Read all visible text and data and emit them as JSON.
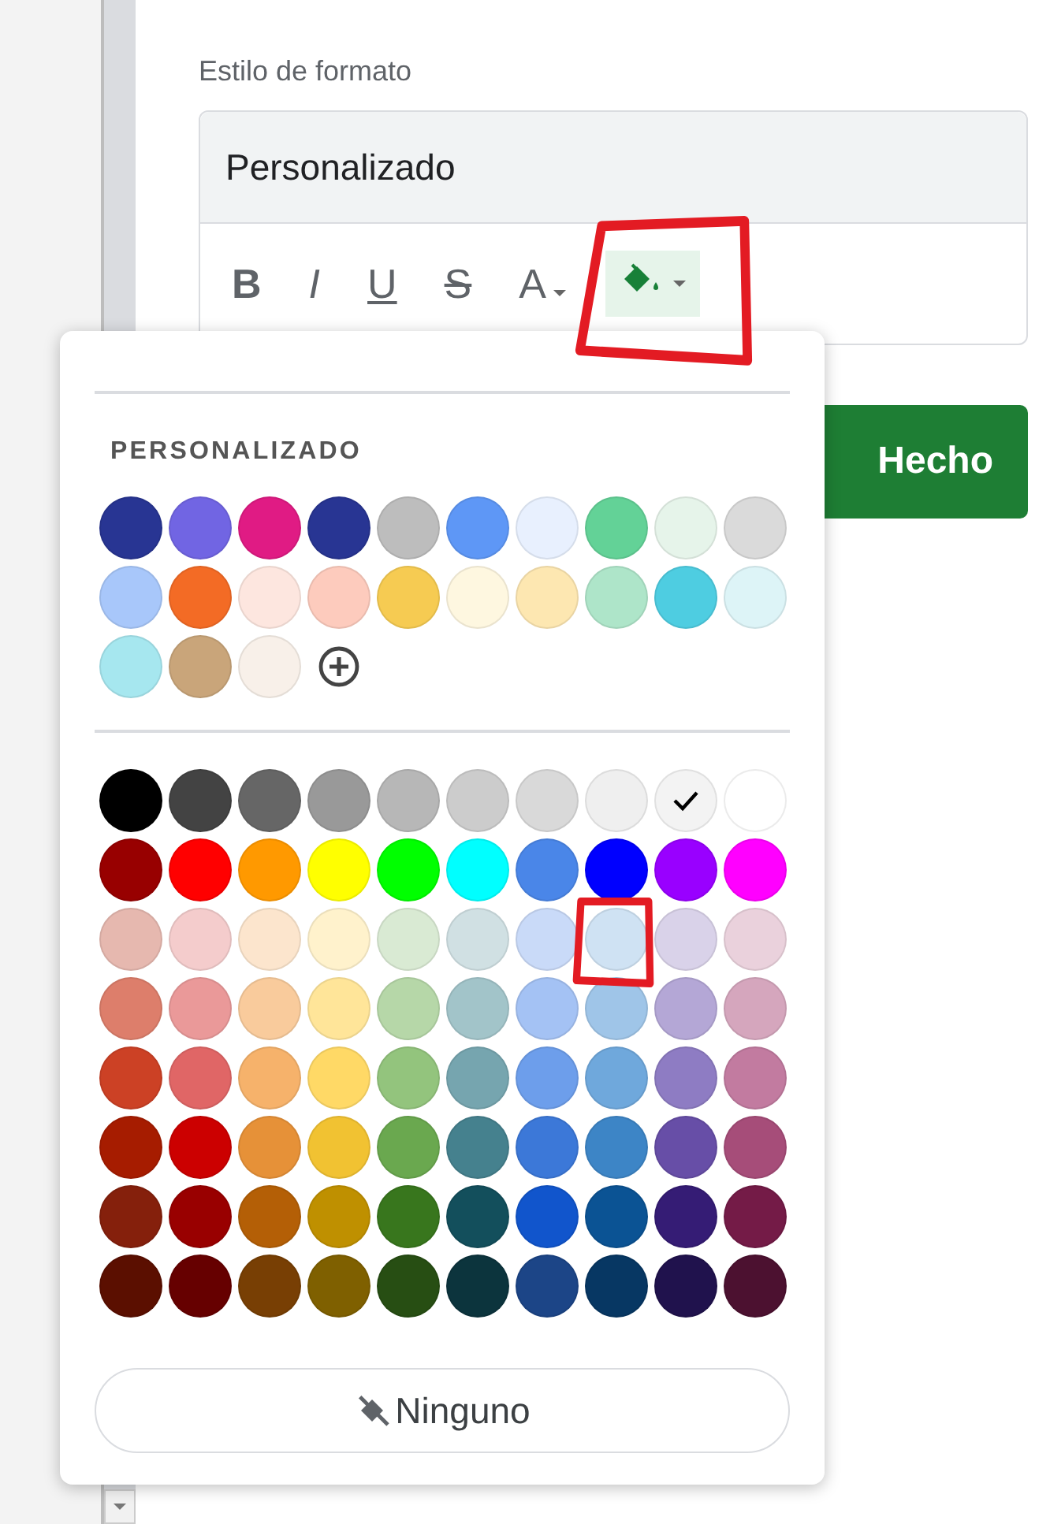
{
  "format_style": {
    "label": "Estilo de formato",
    "preset": "Personalizado",
    "toolbar": [
      {
        "kind": "bold",
        "label": "B",
        "selected": false
      },
      {
        "kind": "italic",
        "label": "I",
        "selected": false
      },
      {
        "kind": "underline",
        "label": "U",
        "selected": false
      },
      {
        "kind": "strike",
        "label": "S",
        "selected": false
      },
      {
        "kind": "text_color",
        "label": "A",
        "selected": false
      },
      {
        "kind": "fill_color",
        "selected": true,
        "highlighted": true
      }
    ]
  },
  "done_button": "Hecho",
  "color_menu": {
    "custom_heading": "PERSONALIZADO",
    "custom": [
      {
        "color": "#283593",
        "selected": false
      },
      {
        "color": "#7165e3",
        "selected": false
      },
      {
        "color": "#e01b84",
        "selected": false
      },
      {
        "color": "#283593",
        "selected": false
      },
      {
        "color": "#bdbdbd",
        "selected": false
      },
      {
        "color": "#5e97f6",
        "selected": false
      },
      {
        "color": "#e8f0fe",
        "selected": false
      },
      {
        "color": "#63d297",
        "selected": false
      },
      {
        "color": "#e6f4ea",
        "selected": false
      },
      {
        "color": "#dadada",
        "selected": false
      },
      {
        "color": "#a8c7fa",
        "selected": false
      },
      {
        "color": "#f36b25",
        "selected": false
      },
      {
        "color": "#fde6df",
        "selected": false
      },
      {
        "color": "#fdcbbd",
        "selected": false
      },
      {
        "color": "#f6cb52",
        "selected": false
      },
      {
        "color": "#fef7e0",
        "selected": false
      },
      {
        "color": "#fde7b1",
        "selected": false
      },
      {
        "color": "#aee5c9",
        "selected": false
      },
      {
        "color": "#4ecde1",
        "selected": false
      },
      {
        "color": "#ddf4f7",
        "selected": false
      },
      {
        "color": "#a6e7ef",
        "selected": false
      },
      {
        "color": "#c9a57a",
        "selected": false
      },
      {
        "color": "#f8f0e9",
        "selected": false
      }
    ],
    "standard": [
      [
        {
          "color": "#000000",
          "selected": false
        },
        {
          "color": "#434343",
          "selected": false
        },
        {
          "color": "#666666",
          "selected": false
        },
        {
          "color": "#999999",
          "selected": false
        },
        {
          "color": "#b7b7b7",
          "selected": false
        },
        {
          "color": "#cccccc",
          "selected": false
        },
        {
          "color": "#d9d9d9",
          "selected": false
        },
        {
          "color": "#efefef",
          "selected": false
        },
        {
          "color": "#f3f3f3",
          "selected": true
        },
        {
          "color": "#ffffff",
          "selected": false
        }
      ],
      [
        {
          "color": "#980000",
          "selected": false
        },
        {
          "color": "#ff0000",
          "selected": false
        },
        {
          "color": "#ff9900",
          "selected": false
        },
        {
          "color": "#ffff00",
          "selected": false
        },
        {
          "color": "#00ff00",
          "selected": false
        },
        {
          "color": "#00ffff",
          "selected": false
        },
        {
          "color": "#4a86e8",
          "selected": false
        },
        {
          "color": "#0000ff",
          "selected": false
        },
        {
          "color": "#9900ff",
          "selected": false
        },
        {
          "color": "#ff00ff",
          "selected": false
        }
      ],
      [
        {
          "color": "#e6b8af",
          "selected": false
        },
        {
          "color": "#f4cccc",
          "selected": false
        },
        {
          "color": "#fce5cd",
          "selected": false
        },
        {
          "color": "#fff2cc",
          "selected": false
        },
        {
          "color": "#d9ead3",
          "selected": false
        },
        {
          "color": "#d0e0e3",
          "selected": false
        },
        {
          "color": "#c9daf8",
          "selected": false
        },
        {
          "color": "#cfe2f3",
          "selected": false,
          "highlighted": true
        },
        {
          "color": "#d9d2e9",
          "selected": false
        },
        {
          "color": "#ead1dc",
          "selected": false
        }
      ],
      [
        {
          "color": "#dd7e6b",
          "selected": false
        },
        {
          "color": "#ea9999",
          "selected": false
        },
        {
          "color": "#f9cb9c",
          "selected": false
        },
        {
          "color": "#ffe599",
          "selected": false
        },
        {
          "color": "#b6d7a8",
          "selected": false
        },
        {
          "color": "#a2c4c9",
          "selected": false
        },
        {
          "color": "#a4c2f4",
          "selected": false
        },
        {
          "color": "#9fc5e8",
          "selected": false
        },
        {
          "color": "#b4a7d6",
          "selected": false
        },
        {
          "color": "#d5a6bd",
          "selected": false
        }
      ],
      [
        {
          "color": "#cc4125",
          "selected": false
        },
        {
          "color": "#e06666",
          "selected": false
        },
        {
          "color": "#f6b26b",
          "selected": false
        },
        {
          "color": "#ffd966",
          "selected": false
        },
        {
          "color": "#93c47d",
          "selected": false
        },
        {
          "color": "#76a5af",
          "selected": false
        },
        {
          "color": "#6d9eeb",
          "selected": false
        },
        {
          "color": "#6fa8dc",
          "selected": false
        },
        {
          "color": "#8e7cc3",
          "selected": false
        },
        {
          "color": "#c27ba0",
          "selected": false
        }
      ],
      [
        {
          "color": "#a61c00",
          "selected": false
        },
        {
          "color": "#cc0000",
          "selected": false
        },
        {
          "color": "#e69138",
          "selected": false
        },
        {
          "color": "#f1c232",
          "selected": false
        },
        {
          "color": "#6aa84f",
          "selected": false
        },
        {
          "color": "#45818e",
          "selected": false
        },
        {
          "color": "#3c78d8",
          "selected": false
        },
        {
          "color": "#3d85c6",
          "selected": false
        },
        {
          "color": "#674ea7",
          "selected": false
        },
        {
          "color": "#a64d79",
          "selected": false
        }
      ],
      [
        {
          "color": "#85200c",
          "selected": false
        },
        {
          "color": "#990000",
          "selected": false
        },
        {
          "color": "#b45f06",
          "selected": false
        },
        {
          "color": "#bf9000",
          "selected": false
        },
        {
          "color": "#38761d",
          "selected": false
        },
        {
          "color": "#134f5c",
          "selected": false
        },
        {
          "color": "#1155cc",
          "selected": false
        },
        {
          "color": "#0b5394",
          "selected": false
        },
        {
          "color": "#351c75",
          "selected": false
        },
        {
          "color": "#741b47",
          "selected": false
        }
      ],
      [
        {
          "color": "#5b0f00",
          "selected": false
        },
        {
          "color": "#660000",
          "selected": false
        },
        {
          "color": "#783f04",
          "selected": false
        },
        {
          "color": "#7f6000",
          "selected": false
        },
        {
          "color": "#274e13",
          "selected": false
        },
        {
          "color": "#0c343d",
          "selected": false
        },
        {
          "color": "#1c4587",
          "selected": false
        },
        {
          "color": "#073763",
          "selected": false
        },
        {
          "color": "#20124d",
          "selected": false
        },
        {
          "color": "#4c1130",
          "selected": false
        }
      ]
    ],
    "none_button": "Ninguno"
  }
}
